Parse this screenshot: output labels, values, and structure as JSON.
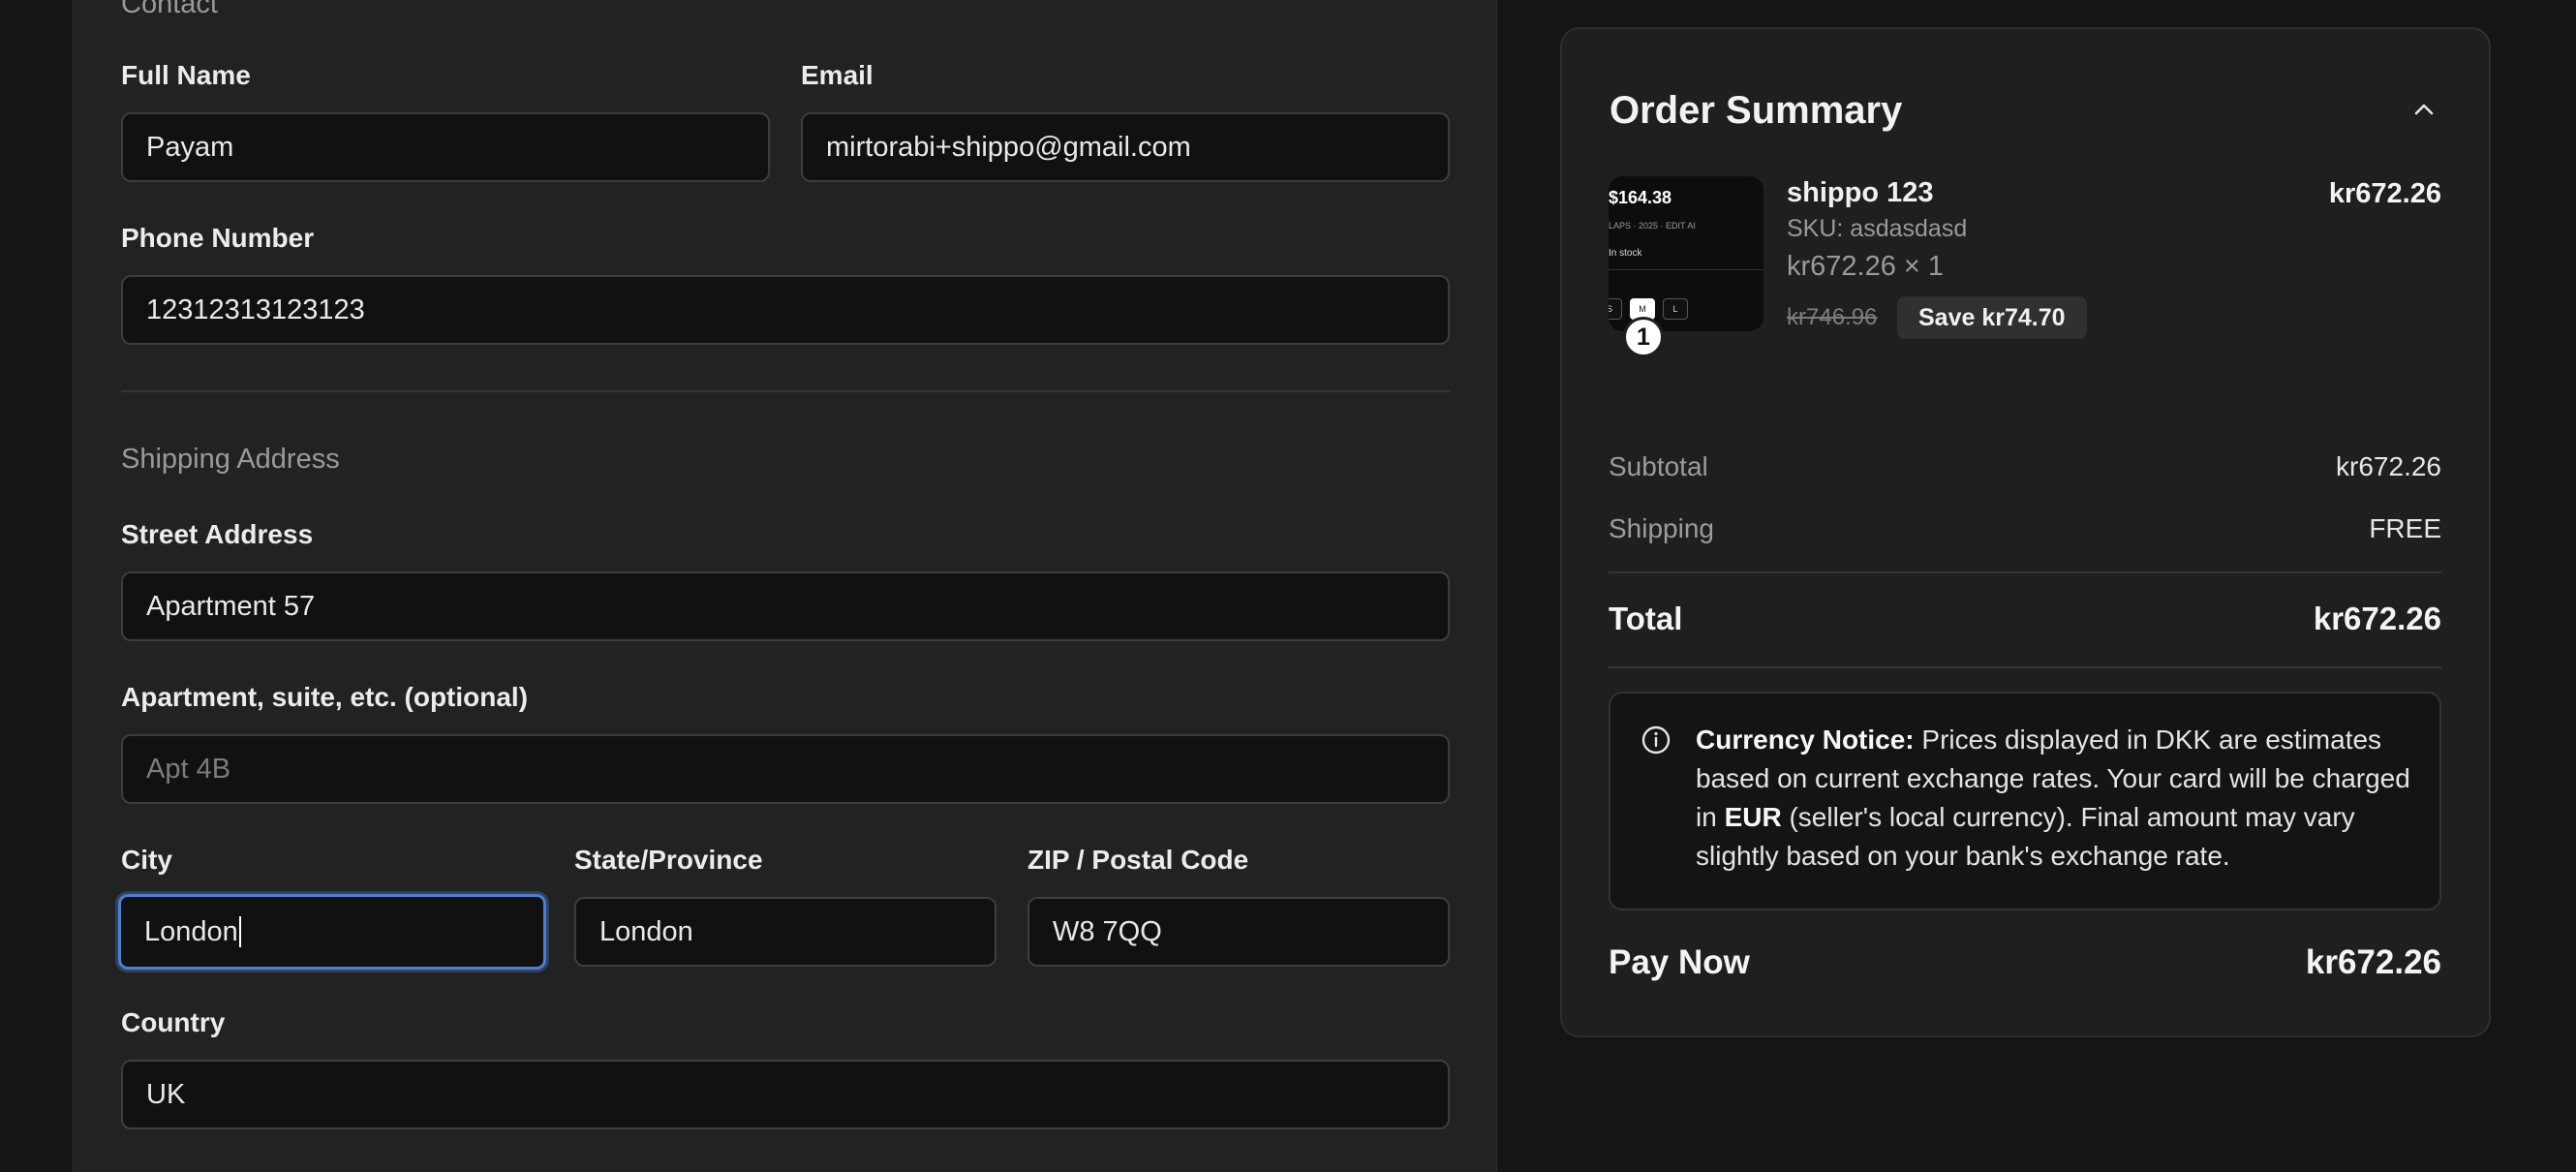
{
  "contact": {
    "heading": "Contact",
    "full_name": {
      "label": "Full Name",
      "value": "Payam"
    },
    "email": {
      "label": "Email",
      "value": "mirtorabi+shippo@gmail.com"
    },
    "phone": {
      "label": "Phone Number",
      "value": "12312313123123"
    }
  },
  "shipping": {
    "heading": "Shipping Address",
    "street": {
      "label": "Street Address",
      "value": "Apartment 57"
    },
    "apartment": {
      "label": "Apartment, suite, etc. (optional)",
      "value": "",
      "placeholder": "Apt 4B"
    },
    "city": {
      "label": "City",
      "value": "London"
    },
    "state": {
      "label": "State/Province",
      "value": "London"
    },
    "zip": {
      "label": "ZIP / Postal Code",
      "value": "W8 7QQ"
    },
    "country": {
      "label": "Country",
      "value": "UK"
    }
  },
  "summary": {
    "title": "Order Summary",
    "item": {
      "thumb_price": "$164.38",
      "thumb_meta": "LAPS · 2025 · EDIT AI",
      "thumb_stock": "In stock",
      "thumb_sizes": [
        "S",
        "M",
        "L"
      ],
      "quantity_badge": "1",
      "name": "shippo 123",
      "sku": "SKU: asdasdasd",
      "qty_line": "kr672.26 × 1",
      "original_price": "kr746.96",
      "save_label": "Save kr74.70",
      "price": "kr672.26"
    },
    "subtotal": {
      "label": "Subtotal",
      "value": "kr672.26"
    },
    "shipping": {
      "label": "Shipping",
      "value": "FREE"
    },
    "total": {
      "label": "Total",
      "value": "kr672.26"
    },
    "notice": {
      "title": "Currency Notice:",
      "text_1": " Prices displayed in DKK are estimates based on current exchange rates. Your card will be charged in ",
      "currency": "EUR",
      "text_2": " (seller's local currency). Final amount may vary slightly based on your bank's exchange rate."
    },
    "pay_now": {
      "label": "Pay Now",
      "value": "kr672.26"
    }
  }
}
